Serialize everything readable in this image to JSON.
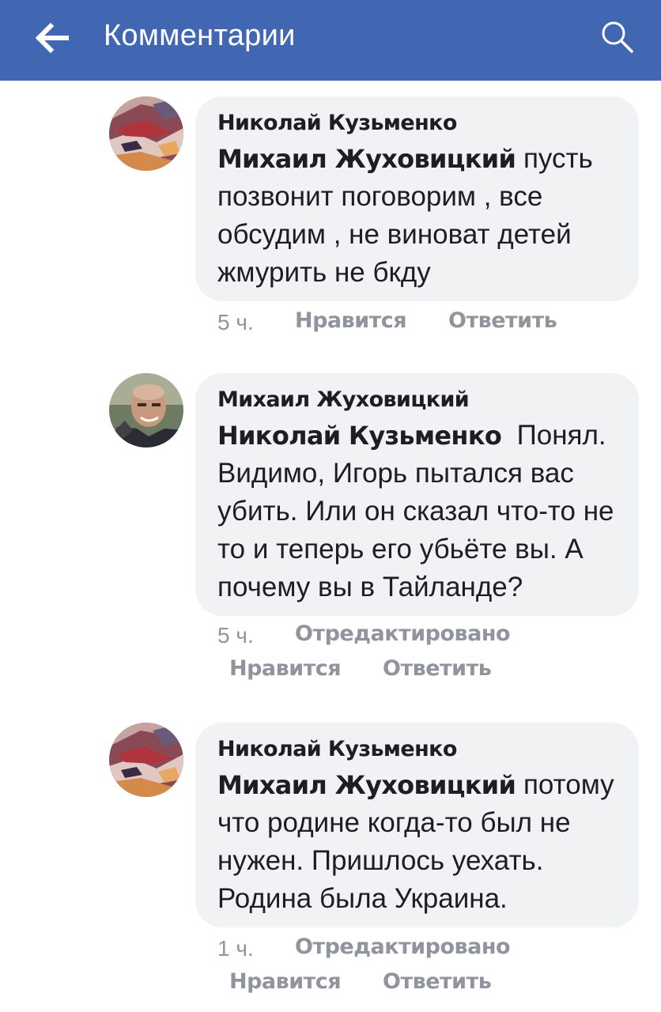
{
  "header": {
    "title": "Комментарии",
    "background_color": "#4267b2",
    "back_icon": "arrow-left-icon",
    "search_icon": "search-icon"
  },
  "comments": [
    {
      "author": "Николай Кузьменко",
      "mention": "Михаил Жуховицкий",
      "text": " пусть позвонит поговорим , все обсудим , не виноват детей жмурить не бкду",
      "time": "5 ч.",
      "edited": "",
      "like_label": "Нравится",
      "reply_label": "Ответить"
    },
    {
      "author": "Михаил Жуховицкий",
      "mention": "Николай Кузьменко",
      "text": "  Понял. Видимо, Игорь пытался вас убить. Или он сказал что-то не то и теперь его убьёте вы. А почему вы в Тайланде?",
      "time": "5 ч.",
      "edited": "Отредактировано",
      "like_label": "Нравится",
      "reply_label": "Ответить"
    },
    {
      "author": "Николай Кузьменко",
      "mention": "Михаил Жуховицкий",
      "text": " потому что родине когда-то был не нужен. Пришлось уехать. Родина была Украина.",
      "time": "1 ч.",
      "edited": "Отредактировано",
      "like_label": "Нравится",
      "reply_label": "Ответить"
    }
  ]
}
